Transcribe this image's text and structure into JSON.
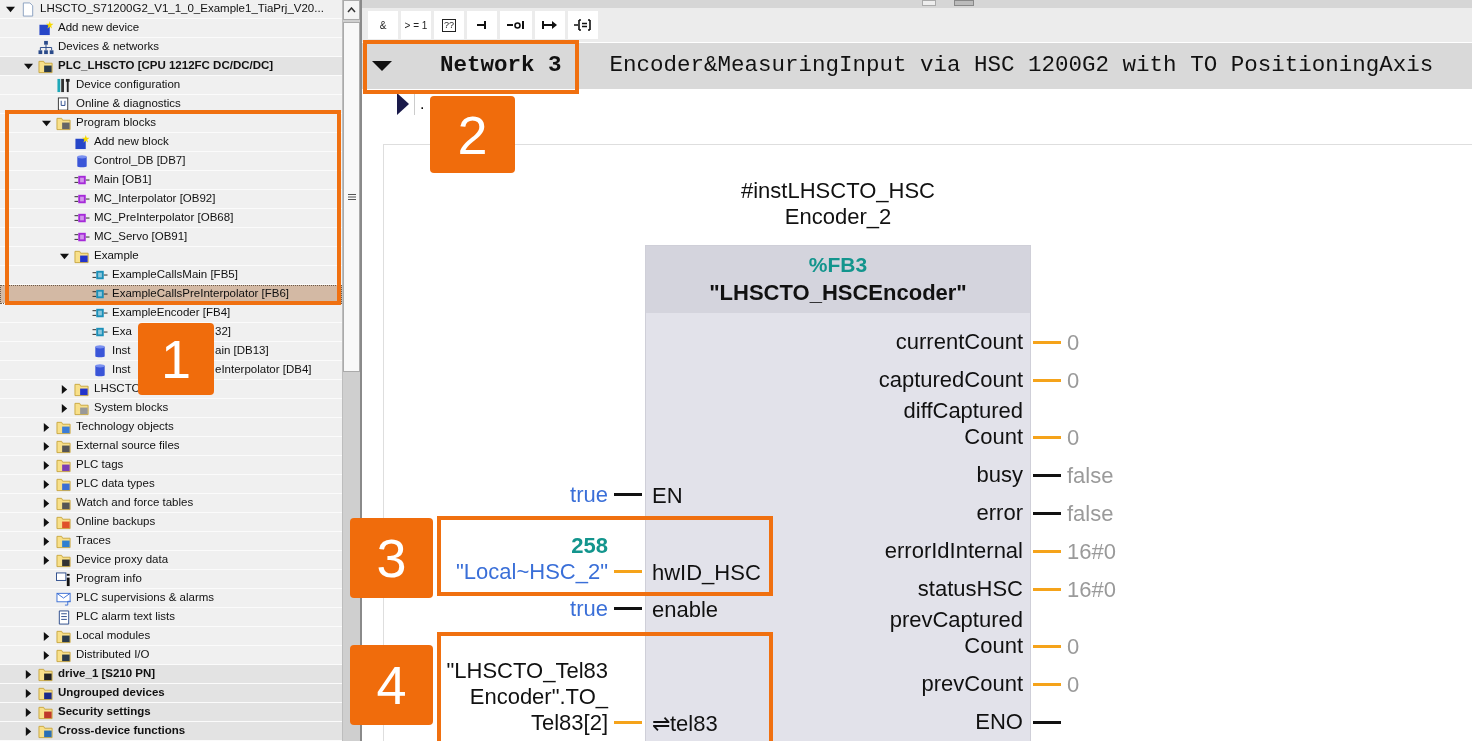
{
  "tree": {
    "items": [
      {
        "label": "LHSCTO_S71200G2_V1_1_0_Example1_TiaPrj_V20...",
        "kind": "project",
        "expanded": true,
        "selected": false,
        "children": [
          {
            "label": "Add new device",
            "kind": "add",
            "selected": false
          },
          {
            "label": "Devices & networks",
            "kind": "network",
            "selected": false
          },
          {
            "label": "PLC_LHSCTO [CPU 1212FC DC/DC/DC]",
            "kind": "device",
            "expanded": true,
            "selected": false,
            "children": [
              {
                "label": "Device configuration",
                "kind": "config",
                "selected": false
              },
              {
                "label": "Online & diagnostics",
                "kind": "diag",
                "selected": false
              },
              {
                "label": "Program blocks",
                "kind": "blocks",
                "expanded": true,
                "selected": false,
                "children": [
                  {
                    "label": "Add new block",
                    "kind": "add",
                    "selected": false
                  },
                  {
                    "label": "Control_DB [DB7]",
                    "kind": "db",
                    "selected": false
                  },
                  {
                    "label": "Main [OB1]",
                    "kind": "ob",
                    "selected": false
                  },
                  {
                    "label": "MC_Interpolator [OB92]",
                    "kind": "ob",
                    "selected": false
                  },
                  {
                    "label": "MC_PreInterpolator [OB68]",
                    "kind": "ob",
                    "selected": false
                  },
                  {
                    "label": "MC_Servo [OB91]",
                    "kind": "ob",
                    "selected": false
                  },
                  {
                    "label": "Example",
                    "kind": "group",
                    "expanded": true,
                    "selected": false,
                    "children": [
                      {
                        "label": "ExampleCallsMain [FB5]",
                        "kind": "fb",
                        "selected": false
                      },
                      {
                        "label": "ExampleCallsPreInterpolator [FB6]",
                        "kind": "fb",
                        "selected": true
                      },
                      {
                        "label": "ExampleEncoder [FB4]",
                        "kind": "fb",
                        "selected": false
                      },
                      {
                        "label": "Exa",
                        "label_end": "32]",
                        "kind": "fb",
                        "selected": false
                      },
                      {
                        "label": "Inst",
                        "label_end": "ain [DB13]",
                        "kind": "db",
                        "selected": false
                      },
                      {
                        "label": "Inst",
                        "label_end": "eInterpolator [DB4]",
                        "kind": "db",
                        "selected": false
                      }
                    ]
                  },
                  {
                    "label": "LHSCTO",
                    "kind": "group",
                    "expanded": false,
                    "selected": false
                  },
                  {
                    "label": "System blocks",
                    "kind": "sysblocks",
                    "expanded": false,
                    "selected": false
                  }
                ]
              },
              {
                "label": "Technology objects",
                "kind": "techobj",
                "expanded": false,
                "selected": false
              },
              {
                "label": "External source files",
                "kind": "source",
                "expanded": false,
                "selected": false
              },
              {
                "label": "PLC tags",
                "kind": "tags",
                "expanded": false,
                "selected": false
              },
              {
                "label": "PLC data types",
                "kind": "types",
                "expanded": false,
                "selected": false
              },
              {
                "label": "Watch and force tables",
                "kind": "watch",
                "expanded": false,
                "selected": false
              },
              {
                "label": "Online backups",
                "kind": "backup",
                "expanded": false,
                "selected": false
              },
              {
                "label": "Traces",
                "kind": "traces",
                "expanded": false,
                "selected": false
              },
              {
                "label": "Device proxy data",
                "kind": "proxy",
                "expanded": false,
                "selected": false
              },
              {
                "label": "Program info",
                "kind": "info",
                "selected": false
              },
              {
                "label": "PLC supervisions & alarms",
                "kind": "alarms",
                "selected": false
              },
              {
                "label": "PLC alarm text lists",
                "kind": "textlist",
                "selected": false
              },
              {
                "label": "Local modules",
                "kind": "modules",
                "expanded": false,
                "selected": false
              },
              {
                "label": "Distributed I/O",
                "kind": "modules",
                "expanded": false,
                "selected": false
              }
            ]
          },
          {
            "label": "drive_1 [S210 PN]",
            "kind": "drive",
            "expanded": false,
            "selected": false
          },
          {
            "label": "Ungrouped devices",
            "kind": "ungrouped",
            "expanded": false,
            "selected": false
          },
          {
            "label": "Security settings",
            "kind": "security",
            "expanded": false,
            "selected": false
          },
          {
            "label": "Cross-device functions",
            "kind": "crossdevice",
            "expanded": false,
            "selected": false
          }
        ]
      }
    ]
  },
  "toolbar": [
    {
      "kind": "text",
      "label": "&"
    },
    {
      "kind": "text",
      "label": "> = 1"
    },
    {
      "kind": "box",
      "label": "??"
    },
    {
      "kind": "contact"
    },
    {
      "kind": "negated"
    },
    {
      "kind": "jump"
    },
    {
      "kind": "assign"
    }
  ],
  "network": {
    "expanded": true,
    "title": "Network 3",
    "comment": "Encoder&MeasuringInput via HSC 1200G2 with TO PositioningAxis",
    "title_row": {
      "expanded": false,
      "text": "."
    },
    "block": {
      "instance_lines": [
        "#instLHSCTO_HSC",
        "Encoder_2"
      ],
      "address": "%FB3",
      "name": "\"LHSCTO_HSCEncoder\"",
      "inputs": [
        {
          "label": "EN",
          "kind": "bool",
          "values": [
            {
              "text": "true",
              "kind": "constant"
            }
          ]
        },
        {
          "label": "hwID_HSC",
          "kind": "data",
          "values": [
            {
              "text": "258",
              "kind": "address"
            },
            {
              "text": "\"Local~HSC_2\"",
              "kind": "constant"
            }
          ]
        },
        {
          "label": "enable",
          "kind": "bool",
          "values": [
            {
              "text": "true",
              "kind": "constant"
            }
          ]
        },
        {
          "label": "⇌tel83",
          "kind": "data",
          "values": [
            {
              "text": "\"LHSCTO_Tel83",
              "kind": "operand"
            },
            {
              "text": "Encoder\".TO_",
              "kind": "operand"
            },
            {
              "text": "Tel83[2]",
              "kind": "operand"
            }
          ]
        }
      ],
      "outputs": [
        {
          "lines": [
            "currentCount"
          ],
          "kind": "data",
          "value": "0"
        },
        {
          "lines": [
            "capturedCount"
          ],
          "kind": "data",
          "value": "0"
        },
        {
          "lines": [
            "diffCaptured",
            "Count"
          ],
          "kind": "data",
          "value": "0"
        },
        {
          "lines": [
            "busy"
          ],
          "kind": "bool",
          "value": "false"
        },
        {
          "lines": [
            "error"
          ],
          "kind": "bool",
          "value": "false"
        },
        {
          "lines": [
            "errorIdInternal"
          ],
          "kind": "data",
          "value": "16#0"
        },
        {
          "lines": [
            "statusHSC"
          ],
          "kind": "data",
          "value": "16#0"
        },
        {
          "lines": [
            "prevCaptured",
            "Count"
          ],
          "kind": "data",
          "value": "0"
        },
        {
          "lines": [
            "prevCount"
          ],
          "kind": "data",
          "value": "0"
        },
        {
          "lines": [
            "ENO"
          ],
          "kind": "bool"
        }
      ]
    }
  },
  "annotations": [
    {
      "label": "1"
    },
    {
      "label": "2"
    },
    {
      "label": "3"
    },
    {
      "label": "4"
    }
  ]
}
